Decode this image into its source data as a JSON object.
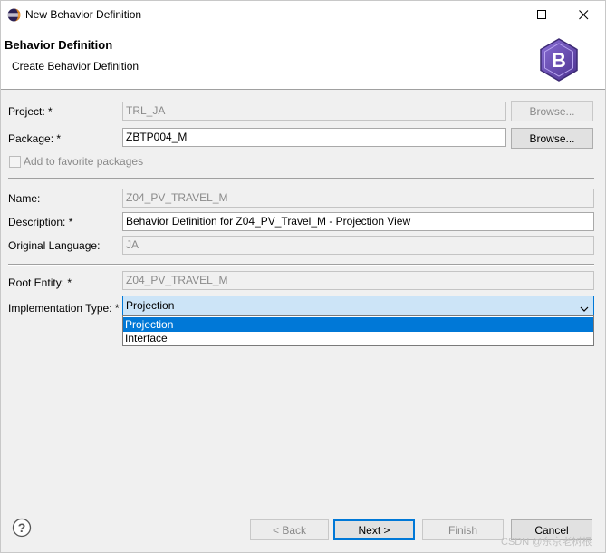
{
  "window": {
    "title": "New Behavior Definition",
    "minimize_icon": "minimize-icon",
    "maximize_icon": "maximize-icon",
    "close_icon": "close-icon"
  },
  "banner": {
    "title": "Behavior Definition",
    "description": "Create Behavior Definition",
    "logo_letter": "B",
    "logo_color": "#6a4fb0"
  },
  "form": {
    "project": {
      "label": "Project: *",
      "value": "TRL_JA",
      "browse_label": "Browse..."
    },
    "package": {
      "label": "Package: *",
      "value": "ZBTP004_M",
      "browse_label": "Browse..."
    },
    "favorite_checkbox": {
      "label": "Add to favorite packages",
      "checked": false
    },
    "name": {
      "label": "Name:",
      "value": "Z04_PV_TRAVEL_M"
    },
    "description": {
      "label": "Description: *",
      "value": "Behavior Definition for Z04_PV_Travel_M - Projection View"
    },
    "original_language": {
      "label": "Original Language:",
      "value": "JA"
    },
    "root_entity": {
      "label": "Root Entity: *",
      "value": "Z04_PV_TRAVEL_M"
    },
    "implementation_type": {
      "label": "Implementation Type: *",
      "selected": "Projection",
      "options": [
        "Projection",
        "Interface"
      ]
    }
  },
  "footer": {
    "help_icon": "help-icon",
    "back_label": "< Back",
    "next_label": "Next >",
    "finish_label": "Finish",
    "cancel_label": "Cancel",
    "watermark": "CSDN @东京老树根"
  },
  "colors": {
    "accent": "#0078d7",
    "combo_background": "#cce4f7",
    "disabled_text": "#8a8a8a"
  }
}
